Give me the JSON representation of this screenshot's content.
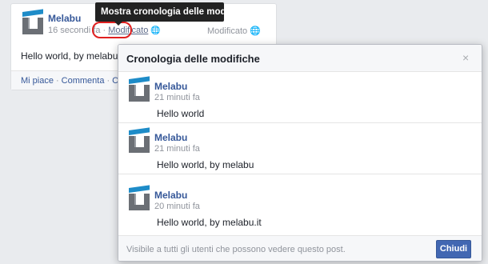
{
  "post": {
    "author": "Melabu",
    "time": "16 secondi fa",
    "dot": " · ",
    "edited_label": "Modificato",
    "globe_icon": "🌐",
    "right_meta": "Modificato",
    "text": "Hello world, by melabu.it",
    "actions": {
      "like": "Mi piace",
      "comment": "Commenta",
      "share": "Condivi",
      "sep": "·"
    }
  },
  "tooltip": {
    "text": "Mostra cronologia delle modifiche"
  },
  "dialog": {
    "title": "Cronologia delle modifiche",
    "close_icon": "×",
    "entries": [
      {
        "author": "Melabu",
        "time": "21 minuti fa",
        "text": "Hello world"
      },
      {
        "author": "Melabu",
        "time": "21 minuti fa",
        "text": "Hello world, by melabu"
      },
      {
        "author": "Melabu",
        "time": "20 minuti fa",
        "text": "Hello world, by melabu.it"
      }
    ],
    "footer_note": "Visibile a tutti gli utenti che possono vedere questo post.",
    "close_button": "Chiudi"
  },
  "colors": {
    "link": "#365899",
    "button": "#4267b2",
    "highlight_ring": "#e02020",
    "logo_blue": "#1e8cc8"
  }
}
